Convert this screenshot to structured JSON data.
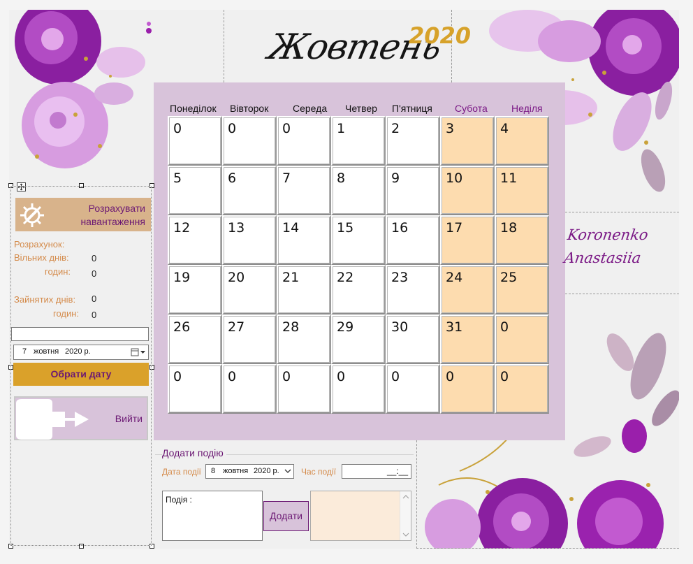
{
  "header": {
    "month": "Жовтень",
    "year": "2020"
  },
  "weekdays": [
    {
      "label": "Понеділок",
      "weekend": false
    },
    {
      "label": "Вівторок",
      "weekend": false
    },
    {
      "label": "Середа",
      "weekend": false
    },
    {
      "label": "Четвер",
      "weekend": false
    },
    {
      "label": "П'ятниця",
      "weekend": false
    },
    {
      "label": "Субота",
      "weekend": true
    },
    {
      "label": "Неділя",
      "weekend": true
    }
  ],
  "calendar_rows": [
    [
      "0",
      "0",
      "0",
      "1",
      "2",
      "3",
      "4"
    ],
    [
      "5",
      "6",
      "7",
      "8",
      "9",
      "10",
      "11"
    ],
    [
      "12",
      "13",
      "14",
      "15",
      "16",
      "17",
      "18"
    ],
    [
      "19",
      "20",
      "21",
      "22",
      "23",
      "24",
      "25"
    ],
    [
      "26",
      "27",
      "28",
      "29",
      "30",
      "31",
      "0"
    ],
    [
      "0",
      "0",
      "0",
      "0",
      "0",
      "0",
      "0"
    ]
  ],
  "left_panel": {
    "calc_button_line1": "Розрахувати",
    "calc_button_line2": "навантаження",
    "calc_heading": "Розрахунок:",
    "free_days_label": "Вільних днів:",
    "free_days_value": "0",
    "free_hours_label": "годин:",
    "free_hours_value": "0",
    "busy_days_label": "Зайнятих днів:",
    "busy_days_value": "0",
    "busy_hours_label": "годин:",
    "busy_hours_value": "0",
    "text_input_value": "",
    "date_day": "7",
    "date_month": "жовтня",
    "date_year": "2020 р.",
    "pick_date_label": "Обрати дату",
    "exit_label": "Вийти"
  },
  "author": {
    "line1": "Koronenko",
    "line2": "Anastasiia"
  },
  "add_event": {
    "title": "Додати подію",
    "date_label": "Дата події",
    "date_day": "8",
    "date_month": "жовтня",
    "date_year": "2020 р.",
    "time_label": "Час події",
    "time_value": "__:__",
    "event_text": "Подія :",
    "add_button": "Додати",
    "list_items": []
  },
  "colors": {
    "accent_purple": "#6b1873",
    "weekend_cell": "#fddcaf",
    "panel_lilac": "#d8c3da",
    "gold": "#daa12a",
    "label_orange": "#d48b4b"
  }
}
